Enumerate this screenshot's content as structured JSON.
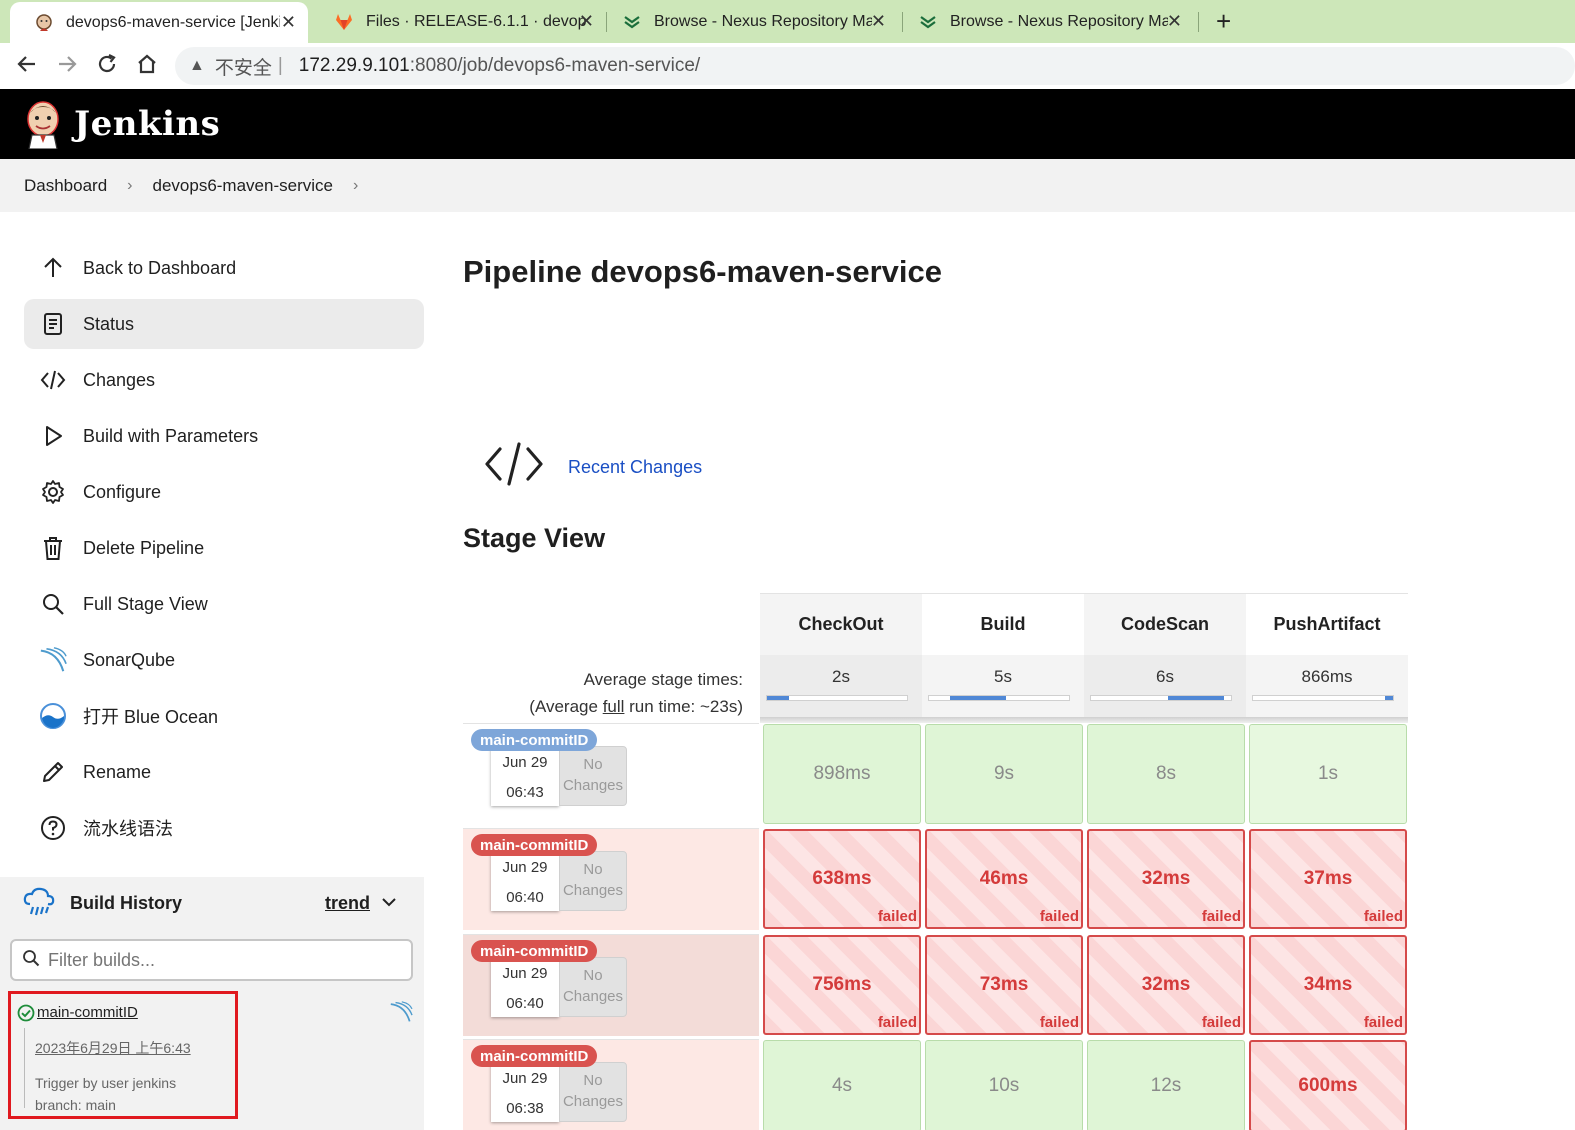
{
  "browser": {
    "tabs": [
      {
        "label": "devops6-maven-service [Jenkins]",
        "active": true
      },
      {
        "label": "Files · RELEASE-6.1.1 · devops6-maven-service",
        "active": false
      },
      {
        "label": "Browse - Nexus Repository Manager",
        "active": false
      },
      {
        "label": "Browse - Nexus Repository Manager",
        "active": false
      }
    ],
    "insecure_label": "不安全",
    "url_host": "172.29.9.101",
    "url_rest": ":8080/job/devops6-maven-service/"
  },
  "header": {
    "title": "Jenkins"
  },
  "breadcrumb": [
    "Dashboard",
    "devops6-maven-service"
  ],
  "sidebar": {
    "items": [
      {
        "label": "Back to Dashboard",
        "icon": "arrow-up-icon"
      },
      {
        "label": "Status",
        "icon": "document-icon",
        "active": true
      },
      {
        "label": "Changes",
        "icon": "code-icon"
      },
      {
        "label": "Build with Parameters",
        "icon": "play-icon"
      },
      {
        "label": "Configure",
        "icon": "gear-icon"
      },
      {
        "label": "Delete Pipeline",
        "icon": "trash-icon"
      },
      {
        "label": "Full Stage View",
        "icon": "search-icon"
      },
      {
        "label": "SonarQube",
        "icon": "sonarqube-icon"
      },
      {
        "label": "打开 Blue Ocean",
        "icon": "blue-ocean-icon"
      },
      {
        "label": "Rename",
        "icon": "pencil-icon"
      },
      {
        "label": "流水线语法",
        "icon": "help-icon"
      }
    ]
  },
  "build_history": {
    "title": "Build History",
    "trend_label": "trend",
    "filter_placeholder": "Filter builds...",
    "builds": [
      {
        "name": "main-commitID",
        "date": "2023年6月29日 上午6:43",
        "trigger": "Trigger by user jenkins",
        "branch": "branch: main"
      }
    ]
  },
  "main": {
    "title": "Pipeline devops6-maven-service",
    "recent_changes": "Recent Changes",
    "stage_view_title": "Stage View"
  },
  "stage_view": {
    "avg_label_line1": "Average stage times:",
    "avg_label_line2_prefix": "(Average ",
    "avg_label_line2_link": "full",
    "avg_label_line2_suffix": " run time: ~23s)",
    "stages": [
      {
        "name": "CheckOut",
        "avg": "2s",
        "bar_start": 0.0,
        "bar_fill": 0.16
      },
      {
        "name": "Build",
        "avg": "5s",
        "bar_start": 0.15,
        "bar_fill": 0.4
      },
      {
        "name": "CodeScan",
        "avg": "6s",
        "bar_start": 0.55,
        "bar_fill": 0.4
      },
      {
        "name": "PushArtifact",
        "avg": "866ms",
        "bar_start": 0.94,
        "bar_fill": 0.06
      }
    ],
    "failed_label": "failed",
    "no_changes_label": "No Changes",
    "runs": [
      {
        "tag": "main-commitID",
        "status": "ok",
        "date": "Jun 29",
        "time": "06:43",
        "cells": [
          {
            "v": "898ms",
            "s": "ok"
          },
          {
            "v": "9s",
            "s": "ok"
          },
          {
            "v": "8s",
            "s": "ok"
          },
          {
            "v": "1s",
            "s": "ok"
          }
        ]
      },
      {
        "tag": "main-commitID",
        "status": "bad",
        "date": "Jun 29",
        "time": "06:40",
        "cells": [
          {
            "v": "638ms",
            "s": "fail"
          },
          {
            "v": "46ms",
            "s": "fail"
          },
          {
            "v": "32ms",
            "s": "fail"
          },
          {
            "v": "37ms",
            "s": "fail"
          }
        ]
      },
      {
        "tag": "main-commitID",
        "status": "bad",
        "date": "Jun 29",
        "time": "06:40",
        "cells": [
          {
            "v": "756ms",
            "s": "fail"
          },
          {
            "v": "73ms",
            "s": "fail"
          },
          {
            "v": "32ms",
            "s": "fail"
          },
          {
            "v": "34ms",
            "s": "fail"
          }
        ]
      },
      {
        "tag": "main-commitID",
        "status": "bad",
        "date": "Jun 29",
        "time": "06:38",
        "cells": [
          {
            "v": "4s",
            "s": "ok"
          },
          {
            "v": "10s",
            "s": "ok"
          },
          {
            "v": "12s",
            "s": "ok"
          },
          {
            "v": "600ms",
            "s": "fail"
          }
        ]
      }
    ]
  },
  "colors": {
    "tabbar": "#cde7b9",
    "link": "#1a4fc4",
    "success": "#dff5d6",
    "failure": "#d43b3b",
    "highlight_box": "#e0191f"
  }
}
